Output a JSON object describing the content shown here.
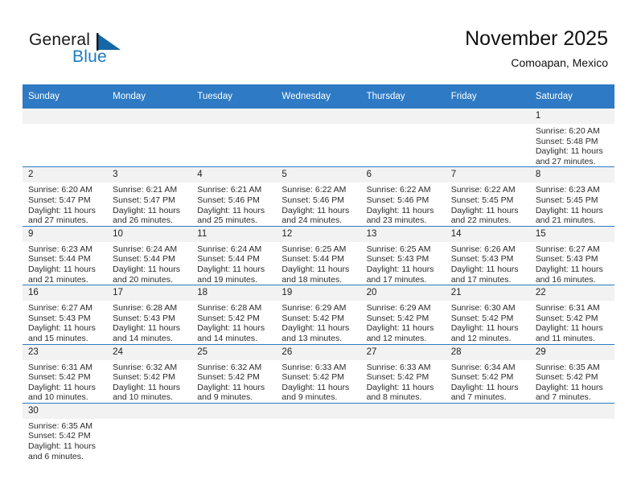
{
  "brand": {
    "name_top": "General",
    "name_bottom": "Blue",
    "flag_icon": "blue-flag-triangle",
    "accent_color": "#1a7bc4"
  },
  "header": {
    "title": "November 2025",
    "subtitle": "Comoapan, Mexico"
  },
  "theme": {
    "header_bg": "#2e7ac4",
    "daynum_bg": "#f2f2f2",
    "grid_line": "#2e7ac4",
    "text": "#2b2b2b"
  },
  "calendar": {
    "weekday_headers": [
      "Sunday",
      "Monday",
      "Tuesday",
      "Wednesday",
      "Thursday",
      "Friday",
      "Saturday"
    ],
    "weeks": [
      [
        {
          "day": "",
          "empty": true
        },
        {
          "day": "",
          "empty": true
        },
        {
          "day": "",
          "empty": true
        },
        {
          "day": "",
          "empty": true
        },
        {
          "day": "",
          "empty": true
        },
        {
          "day": "",
          "empty": true
        },
        {
          "day": "1",
          "sunrise": "Sunrise: 6:20 AM",
          "sunset": "Sunset: 5:48 PM",
          "daylight1": "Daylight: 11 hours",
          "daylight2": "and 27 minutes."
        }
      ],
      [
        {
          "day": "2",
          "sunrise": "Sunrise: 6:20 AM",
          "sunset": "Sunset: 5:47 PM",
          "daylight1": "Daylight: 11 hours",
          "daylight2": "and 27 minutes."
        },
        {
          "day": "3",
          "sunrise": "Sunrise: 6:21 AM",
          "sunset": "Sunset: 5:47 PM",
          "daylight1": "Daylight: 11 hours",
          "daylight2": "and 26 minutes."
        },
        {
          "day": "4",
          "sunrise": "Sunrise: 6:21 AM",
          "sunset": "Sunset: 5:46 PM",
          "daylight1": "Daylight: 11 hours",
          "daylight2": "and 25 minutes."
        },
        {
          "day": "5",
          "sunrise": "Sunrise: 6:22 AM",
          "sunset": "Sunset: 5:46 PM",
          "daylight1": "Daylight: 11 hours",
          "daylight2": "and 24 minutes."
        },
        {
          "day": "6",
          "sunrise": "Sunrise: 6:22 AM",
          "sunset": "Sunset: 5:46 PM",
          "daylight1": "Daylight: 11 hours",
          "daylight2": "and 23 minutes."
        },
        {
          "day": "7",
          "sunrise": "Sunrise: 6:22 AM",
          "sunset": "Sunset: 5:45 PM",
          "daylight1": "Daylight: 11 hours",
          "daylight2": "and 22 minutes."
        },
        {
          "day": "8",
          "sunrise": "Sunrise: 6:23 AM",
          "sunset": "Sunset: 5:45 PM",
          "daylight1": "Daylight: 11 hours",
          "daylight2": "and 21 minutes."
        }
      ],
      [
        {
          "day": "9",
          "sunrise": "Sunrise: 6:23 AM",
          "sunset": "Sunset: 5:44 PM",
          "daylight1": "Daylight: 11 hours",
          "daylight2": "and 21 minutes."
        },
        {
          "day": "10",
          "sunrise": "Sunrise: 6:24 AM",
          "sunset": "Sunset: 5:44 PM",
          "daylight1": "Daylight: 11 hours",
          "daylight2": "and 20 minutes."
        },
        {
          "day": "11",
          "sunrise": "Sunrise: 6:24 AM",
          "sunset": "Sunset: 5:44 PM",
          "daylight1": "Daylight: 11 hours",
          "daylight2": "and 19 minutes."
        },
        {
          "day": "12",
          "sunrise": "Sunrise: 6:25 AM",
          "sunset": "Sunset: 5:44 PM",
          "daylight1": "Daylight: 11 hours",
          "daylight2": "and 18 minutes."
        },
        {
          "day": "13",
          "sunrise": "Sunrise: 6:25 AM",
          "sunset": "Sunset: 5:43 PM",
          "daylight1": "Daylight: 11 hours",
          "daylight2": "and 17 minutes."
        },
        {
          "day": "14",
          "sunrise": "Sunrise: 6:26 AM",
          "sunset": "Sunset: 5:43 PM",
          "daylight1": "Daylight: 11 hours",
          "daylight2": "and 17 minutes."
        },
        {
          "day": "15",
          "sunrise": "Sunrise: 6:27 AM",
          "sunset": "Sunset: 5:43 PM",
          "daylight1": "Daylight: 11 hours",
          "daylight2": "and 16 minutes."
        }
      ],
      [
        {
          "day": "16",
          "sunrise": "Sunrise: 6:27 AM",
          "sunset": "Sunset: 5:43 PM",
          "daylight1": "Daylight: 11 hours",
          "daylight2": "and 15 minutes."
        },
        {
          "day": "17",
          "sunrise": "Sunrise: 6:28 AM",
          "sunset": "Sunset: 5:43 PM",
          "daylight1": "Daylight: 11 hours",
          "daylight2": "and 14 minutes."
        },
        {
          "day": "18",
          "sunrise": "Sunrise: 6:28 AM",
          "sunset": "Sunset: 5:42 PM",
          "daylight1": "Daylight: 11 hours",
          "daylight2": "and 14 minutes."
        },
        {
          "day": "19",
          "sunrise": "Sunrise: 6:29 AM",
          "sunset": "Sunset: 5:42 PM",
          "daylight1": "Daylight: 11 hours",
          "daylight2": "and 13 minutes."
        },
        {
          "day": "20",
          "sunrise": "Sunrise: 6:29 AM",
          "sunset": "Sunset: 5:42 PM",
          "daylight1": "Daylight: 11 hours",
          "daylight2": "and 12 minutes."
        },
        {
          "day": "21",
          "sunrise": "Sunrise: 6:30 AM",
          "sunset": "Sunset: 5:42 PM",
          "daylight1": "Daylight: 11 hours",
          "daylight2": "and 12 minutes."
        },
        {
          "day": "22",
          "sunrise": "Sunrise: 6:31 AM",
          "sunset": "Sunset: 5:42 PM",
          "daylight1": "Daylight: 11 hours",
          "daylight2": "and 11 minutes."
        }
      ],
      [
        {
          "day": "23",
          "sunrise": "Sunrise: 6:31 AM",
          "sunset": "Sunset: 5:42 PM",
          "daylight1": "Daylight: 11 hours",
          "daylight2": "and 10 minutes."
        },
        {
          "day": "24",
          "sunrise": "Sunrise: 6:32 AM",
          "sunset": "Sunset: 5:42 PM",
          "daylight1": "Daylight: 11 hours",
          "daylight2": "and 10 minutes."
        },
        {
          "day": "25",
          "sunrise": "Sunrise: 6:32 AM",
          "sunset": "Sunset: 5:42 PM",
          "daylight1": "Daylight: 11 hours",
          "daylight2": "and 9 minutes."
        },
        {
          "day": "26",
          "sunrise": "Sunrise: 6:33 AM",
          "sunset": "Sunset: 5:42 PM",
          "daylight1": "Daylight: 11 hours",
          "daylight2": "and 9 minutes."
        },
        {
          "day": "27",
          "sunrise": "Sunrise: 6:33 AM",
          "sunset": "Sunset: 5:42 PM",
          "daylight1": "Daylight: 11 hours",
          "daylight2": "and 8 minutes."
        },
        {
          "day": "28",
          "sunrise": "Sunrise: 6:34 AM",
          "sunset": "Sunset: 5:42 PM",
          "daylight1": "Daylight: 11 hours",
          "daylight2": "and 7 minutes."
        },
        {
          "day": "29",
          "sunrise": "Sunrise: 6:35 AM",
          "sunset": "Sunset: 5:42 PM",
          "daylight1": "Daylight: 11 hours",
          "daylight2": "and 7 minutes."
        }
      ],
      [
        {
          "day": "30",
          "sunrise": "Sunrise: 6:35 AM",
          "sunset": "Sunset: 5:42 PM",
          "daylight1": "Daylight: 11 hours",
          "daylight2": "and 6 minutes."
        },
        {
          "day": "",
          "empty": true
        },
        {
          "day": "",
          "empty": true
        },
        {
          "day": "",
          "empty": true
        },
        {
          "day": "",
          "empty": true
        },
        {
          "day": "",
          "empty": true
        },
        {
          "day": "",
          "empty": true
        }
      ]
    ]
  }
}
